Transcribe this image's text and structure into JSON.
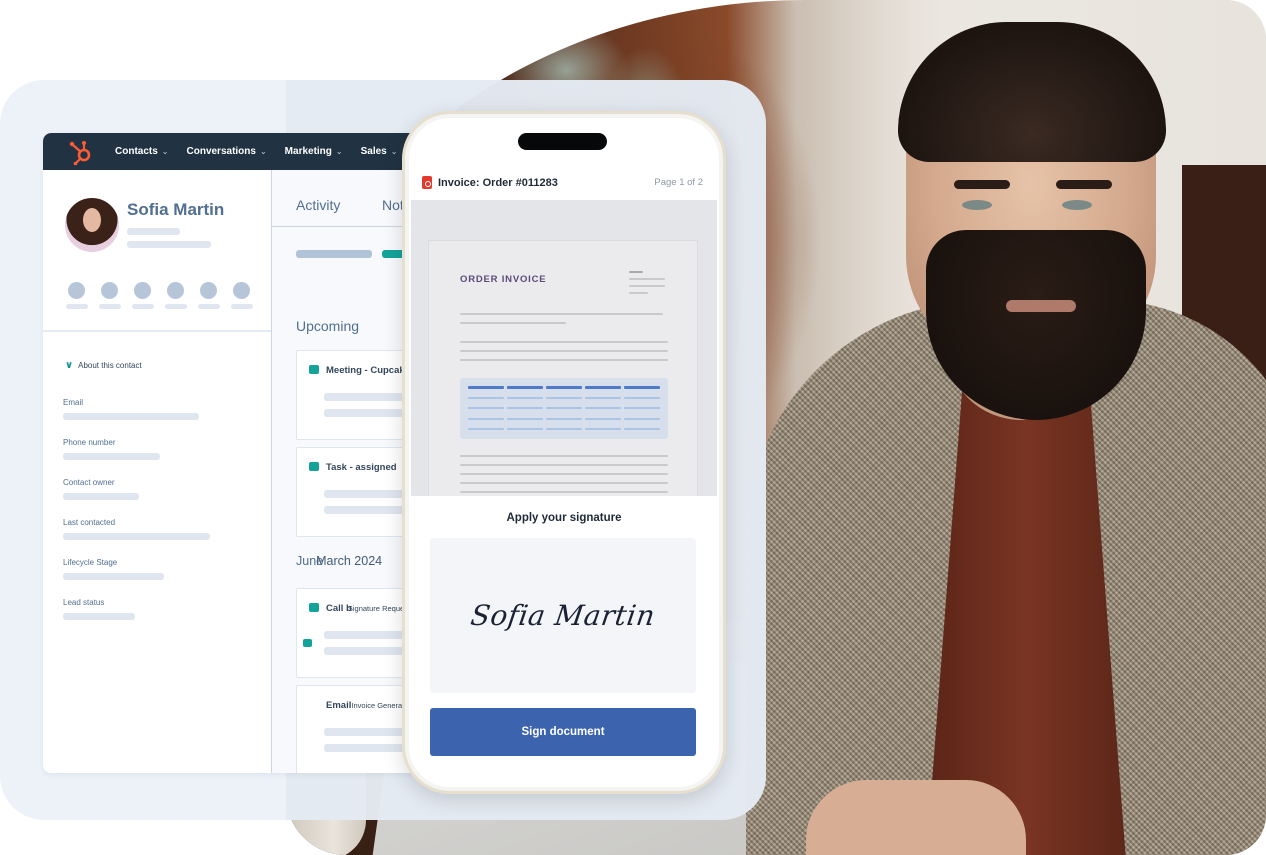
{
  "crm": {
    "nav": {
      "logo_icon": "hubspot-sprocket-icon",
      "items": [
        {
          "label": "Contacts",
          "icon": "chevron-down-icon"
        },
        {
          "label": "Conversations",
          "icon": "chevron-down-icon"
        },
        {
          "label": "Marketing",
          "icon": "chevron-down-icon"
        },
        {
          "label": "Sales",
          "icon": "chevron-down-icon"
        }
      ],
      "chevron": "⌄"
    },
    "contact": {
      "name": "Sofia Martin",
      "avatar": "contact-avatar"
    },
    "about": {
      "label": "About this contact",
      "chevron": "⌄"
    },
    "properties": [
      {
        "label": "Email"
      },
      {
        "label": "Phone number"
      },
      {
        "label": "Contact owner"
      },
      {
        "label": "Last contacted"
      },
      {
        "label": "Lifecycle Stage"
      },
      {
        "label": "Lead status"
      }
    ],
    "tabs": [
      {
        "label": "Activity"
      },
      {
        "label": "Notes"
      }
    ],
    "upcoming": {
      "title": "Upcoming",
      "cards": [
        {
          "title": "Meeting - Cupcakes"
        },
        {
          "title": "Task - assigned"
        }
      ]
    },
    "history": {
      "title_under": "June",
      "title_over": "March 2024",
      "cards": [
        {
          "title_under": "Call b",
          "title_over": "Signature Request"
        },
        {
          "title_under": "Email",
          "title_over": "Invoice Generated"
        }
      ]
    }
  },
  "phone": {
    "document": {
      "icon": "pdf-file-icon",
      "title": "Invoice: Order #011283",
      "page_indicator": "Page 1 of 2",
      "preview_heading": "ORDER INVOICE"
    },
    "signature": {
      "label": "Apply your signature",
      "value": "Sofia Martin"
    },
    "sign_button": "Sign document"
  },
  "colors": {
    "nav_bg": "#213343",
    "accent_teal": "#14a39a",
    "logo_orange": "#ff5c35",
    "button_blue": "#3c63ae",
    "heading_slate": "#516f90"
  }
}
